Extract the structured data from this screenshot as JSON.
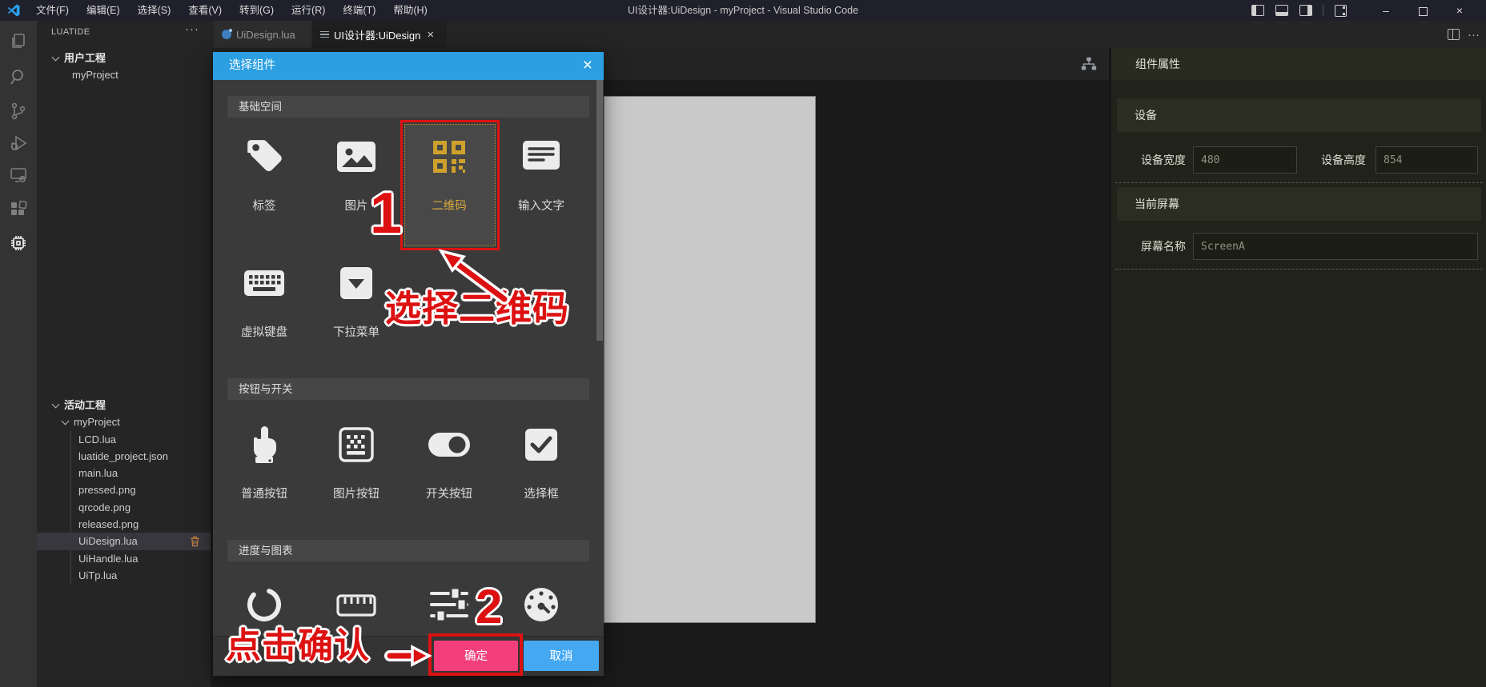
{
  "title_bar": {
    "menus": [
      "文件(F)",
      "编辑(E)",
      "选择(S)",
      "查看(V)",
      "转到(G)",
      "运行(R)",
      "终端(T)",
      "帮助(H)"
    ],
    "title": "UI设计器:UiDesign - myProject - Visual Studio Code"
  },
  "activity_bar": {
    "icons": [
      "explorer-icon",
      "search-icon",
      "source-control-icon",
      "run-debug-icon",
      "remote-explorer-icon",
      "extensions-icon",
      "luatide-chip-icon"
    ]
  },
  "sidebar": {
    "header": "LUATIDE",
    "user_section": {
      "label": "用户工程",
      "project": "myProject"
    },
    "active_section": {
      "label": "活动工程",
      "project": "myProject",
      "files": [
        "LCD.lua",
        "luatide_project.json",
        "main.lua",
        "pressed.png",
        "qrcode.png",
        "released.png",
        "UiDesign.lua",
        "UiHandle.lua",
        "UiTp.lua"
      ],
      "selected_file": "UiDesign.lua"
    }
  },
  "tabs": {
    "tab1": "UiDesign.lua",
    "tab2": "UI设计器:UiDesign"
  },
  "dialog": {
    "title": "选择组件",
    "section1": {
      "title": "基础空间",
      "items": [
        {
          "label": "标签",
          "icon": "tag-icon"
        },
        {
          "label": "图片",
          "icon": "image-icon"
        },
        {
          "label": "二维码",
          "icon": "qrcode-icon",
          "selected": true
        },
        {
          "label": "输入文字",
          "icon": "text-input-icon"
        },
        {
          "label": "虚拟键盘",
          "icon": "keyboard-icon"
        },
        {
          "label": "下拉菜单",
          "icon": "dropdown-icon"
        }
      ]
    },
    "section2": {
      "title": "按钮与开关",
      "items": [
        {
          "label": "普通按钮",
          "icon": "pointer-hand-icon"
        },
        {
          "label": "图片按钮",
          "icon": "image-button-icon"
        },
        {
          "label": "开关按钮",
          "icon": "toggle-icon"
        },
        {
          "label": "选择框",
          "icon": "checkbox-icon"
        }
      ]
    },
    "section3": {
      "title": "进度与图表",
      "items": [
        {
          "icon": "spinner-icon"
        },
        {
          "icon": "ruler-icon"
        },
        {
          "icon": "sliders-icon"
        },
        {
          "icon": "gauge-icon"
        }
      ]
    },
    "ok": "确定",
    "cancel": "取消"
  },
  "annotations": {
    "step1": "1",
    "step2": "2",
    "tip1": "选择二维码",
    "tip2": "点击确认"
  },
  "panel": {
    "title": "组件属性",
    "device": {
      "title": "设备",
      "width_label": "设备宽度",
      "width_value": "480",
      "height_label": "设备高度",
      "height_value": "854"
    },
    "screen": {
      "title": "当前屏幕",
      "name_label": "屏幕名称",
      "name_value": "ScreenA"
    }
  },
  "colors": {
    "modal_header_blue": "#2b9fe2",
    "ok_pink": "#f23f7c",
    "cancel_blue": "#45a8f2",
    "annotation_red": "#dd1111",
    "qr_gold": "#cfa12b"
  }
}
